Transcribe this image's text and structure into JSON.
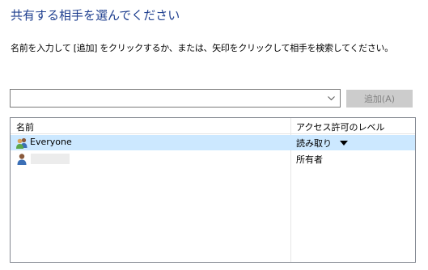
{
  "dialog": {
    "title": "共有する相手を選んでください",
    "instruction": "名前を入力して [追加] をクリックするか、または、矢印をクリックして相手を検索してください。"
  },
  "name_input": {
    "value": "",
    "placeholder": ""
  },
  "add_button": {
    "label": "追加(A)",
    "enabled": false
  },
  "table": {
    "columns": [
      "名前",
      "アクセス許可のレベル"
    ],
    "rows": [
      {
        "name": "Everyone",
        "access": "読み取り",
        "selected": true,
        "icon": "group-users-icon",
        "has_dropdown": true
      },
      {
        "name": "",
        "access": "所有者",
        "selected": false,
        "icon": "user-icon",
        "has_dropdown": false
      }
    ]
  },
  "colors": {
    "title": "#1f3f8f",
    "selected_row": "#cce8ff",
    "disabled_button_bg": "#cccccc",
    "disabled_button_text": "#838383"
  }
}
